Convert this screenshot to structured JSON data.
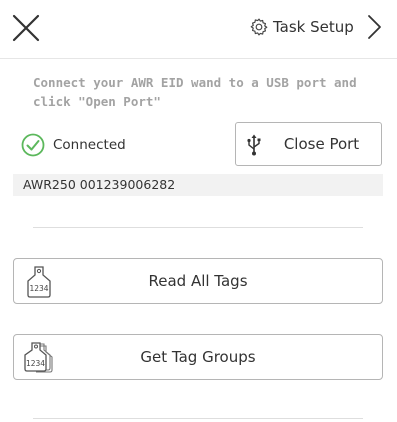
{
  "header": {
    "close_icon": "close-icon",
    "task_setup_label": "Task Setup",
    "gear_icon": "gear-icon",
    "chevron_icon": "chevron-right-icon"
  },
  "instructions": "Connect your AWR EID wand to a USB port and click \"Open Port\"",
  "connection": {
    "status_text": "Connected",
    "status_icon": "check-circle-icon",
    "status_color": "#5cb85c",
    "port_button_label": "Close Port",
    "port_button_icon": "usb-icon"
  },
  "device": {
    "info": "AWR250 001239006282"
  },
  "actions": [
    {
      "label": "Read All Tags",
      "icon": "ear-tag-icon",
      "tag_number": "1234"
    },
    {
      "label": "Get Tag Groups",
      "icon": "ear-tag-stack-icon",
      "tag_number": "1234"
    }
  ]
}
